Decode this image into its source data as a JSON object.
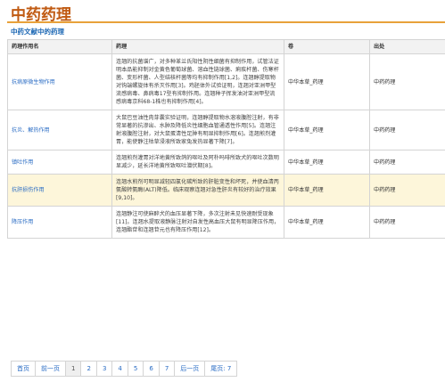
{
  "page": {
    "title": "中药药理",
    "subtitle": "中药文献中的药理"
  },
  "table": {
    "headers": [
      "药理作用名",
      "药理",
      "卷",
      "出处"
    ],
    "rows": [
      {
        "name": "抗病原微生物作用",
        "text": "连翘的抗菌谱广，对多种革兰氏阳性阴性细菌有抑制作用，试管法证明本品能抑制对金黄色葡萄球菌、溶血性链球菌、痢疾杆菌、伤寒杆菌、变形杆菌、人型结核杆菌等均有抑制作用[1,2]。连翘醇提取物对钩端螺旋体有杀灭作用[3]。鸡胚体外试验证明，连翘对亚洲甲型流感病毒、鼻病毒17型有抑制作用。连翘种子挥发油对亚洲甲型流感病毒京科68-1株也有抑制作用[4]。",
        "volume": "中华本草_药理",
        "source": "中药药理",
        "highlight": false
      },
      {
        "name": "抗炎、解热作用",
        "text": "大鼠巴豆油性肉芽囊实验证明，连翘醇提取物水溶液腹腔注射，有非常显著的抗渗出、水肿及降低炎性细胞血管通透性作用[5]。连翘注射液腹腔注射，对大鼠蛋清性足肿有明显抑制作用[6]。连翘煎剂灌胃，能使静注枯草浸液所致家兔发热显著下降[7]。",
        "volume": "中华本草_药理",
        "source": "中药药理",
        "highlight": false
      },
      {
        "name": "镇吐作用",
        "text": "连翘煎剂灌胃对洋地黄所致鸽的呕吐及阿朴吗啡所致犬的呕吐次数明显减少，延长洋地黄所致呕吐潜伏期[8]。",
        "volume": "中华本草_药理",
        "source": "中药药理",
        "highlight": false
      },
      {
        "name": "抗肝损伤作用",
        "text": "连翘水煎剂可明显减轻四氯化碳所致的肝脏变性和坏死，并使血清丙氨酸转氨酶(ALT)降低。临床观察连翘对急性肝炎有较好的治疗效果[9,10]。",
        "volume": "中华本草_药理",
        "source": "中药药理",
        "highlight": true
      },
      {
        "name": "降压作用",
        "text": "连翘静注可使麻醉犬的血压显著下降，多次注射未见快速耐受现象[11]。连翘水提取液静脉注射对自发性高血压大鼠有明显降压作用，连翘酯苷和连翘苷元也有降压作用[12]。",
        "volume": "中华本草_药理",
        "source": "中药药理",
        "highlight": false
      }
    ]
  },
  "pager": {
    "first": "首页",
    "prev": "前一页",
    "pages": [
      "1",
      "2",
      "3",
      "4",
      "5",
      "6",
      "7"
    ],
    "current": "1",
    "next": "后一页",
    "last": "尾页: 7"
  }
}
